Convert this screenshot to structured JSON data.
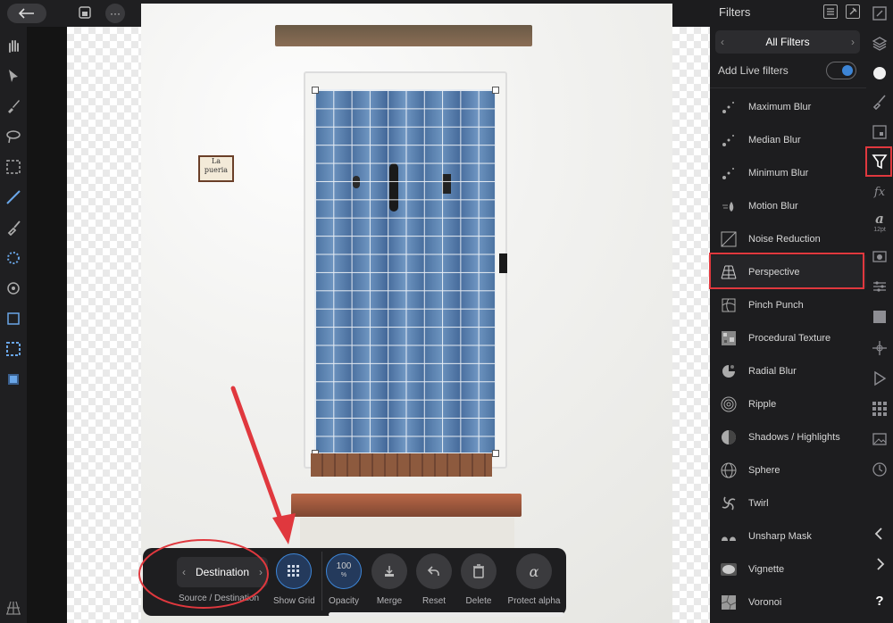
{
  "toolbar": {
    "back_icon": "arrow-left-icon",
    "more_label": "···"
  },
  "canvas": {
    "sign_text": "La pueria"
  },
  "context_toolbar": {
    "destination_label": "Destination",
    "source_destination_label": "Source / Destination",
    "show_grid_label": "Show Grid",
    "opacity_value": "100",
    "opacity_unit": "%",
    "opacity_label": "Opacity",
    "merge_label": "Merge",
    "reset_label": "Reset",
    "delete_label": "Delete",
    "protect_alpha_label": "Protect alpha"
  },
  "filters_panel": {
    "title": "Filters",
    "category": "All Filters",
    "live_filters_label": "Add Live filters",
    "live_filters_on": true,
    "items": [
      {
        "label": "Maximum Blur",
        "icon": "blur-dots-icon"
      },
      {
        "label": "Median Blur",
        "icon": "blur-dots-icon"
      },
      {
        "label": "Minimum Blur",
        "icon": "blur-dots-icon"
      },
      {
        "label": "Motion Blur",
        "icon": "motion-blur-icon"
      },
      {
        "label": "Noise Reduction",
        "icon": "noise-reduction-icon"
      },
      {
        "label": "Perspective",
        "icon": "perspective-grid-icon",
        "selected": true
      },
      {
        "label": "Pinch Punch",
        "icon": "pinch-punch-icon"
      },
      {
        "label": "Procedural Texture",
        "icon": "texture-icon"
      },
      {
        "label": "Radial Blur",
        "icon": "radial-blur-icon"
      },
      {
        "label": "Ripple",
        "icon": "ripple-icon"
      },
      {
        "label": "Shadows / Highlights",
        "icon": "shadows-highlights-icon"
      },
      {
        "label": "Sphere",
        "icon": "sphere-icon"
      },
      {
        "label": "Twirl",
        "icon": "twirl-icon"
      },
      {
        "label": "Unsharp Mask",
        "icon": "unsharp-mask-icon"
      },
      {
        "label": "Vignette",
        "icon": "vignette-icon"
      },
      {
        "label": "Voronoi",
        "icon": "voronoi-icon"
      }
    ]
  },
  "right_strip": {
    "font_size_label": "12pt",
    "help_label": "?"
  },
  "colors": {
    "accent": "#3d85d6",
    "annotation_red": "#e0383e"
  }
}
